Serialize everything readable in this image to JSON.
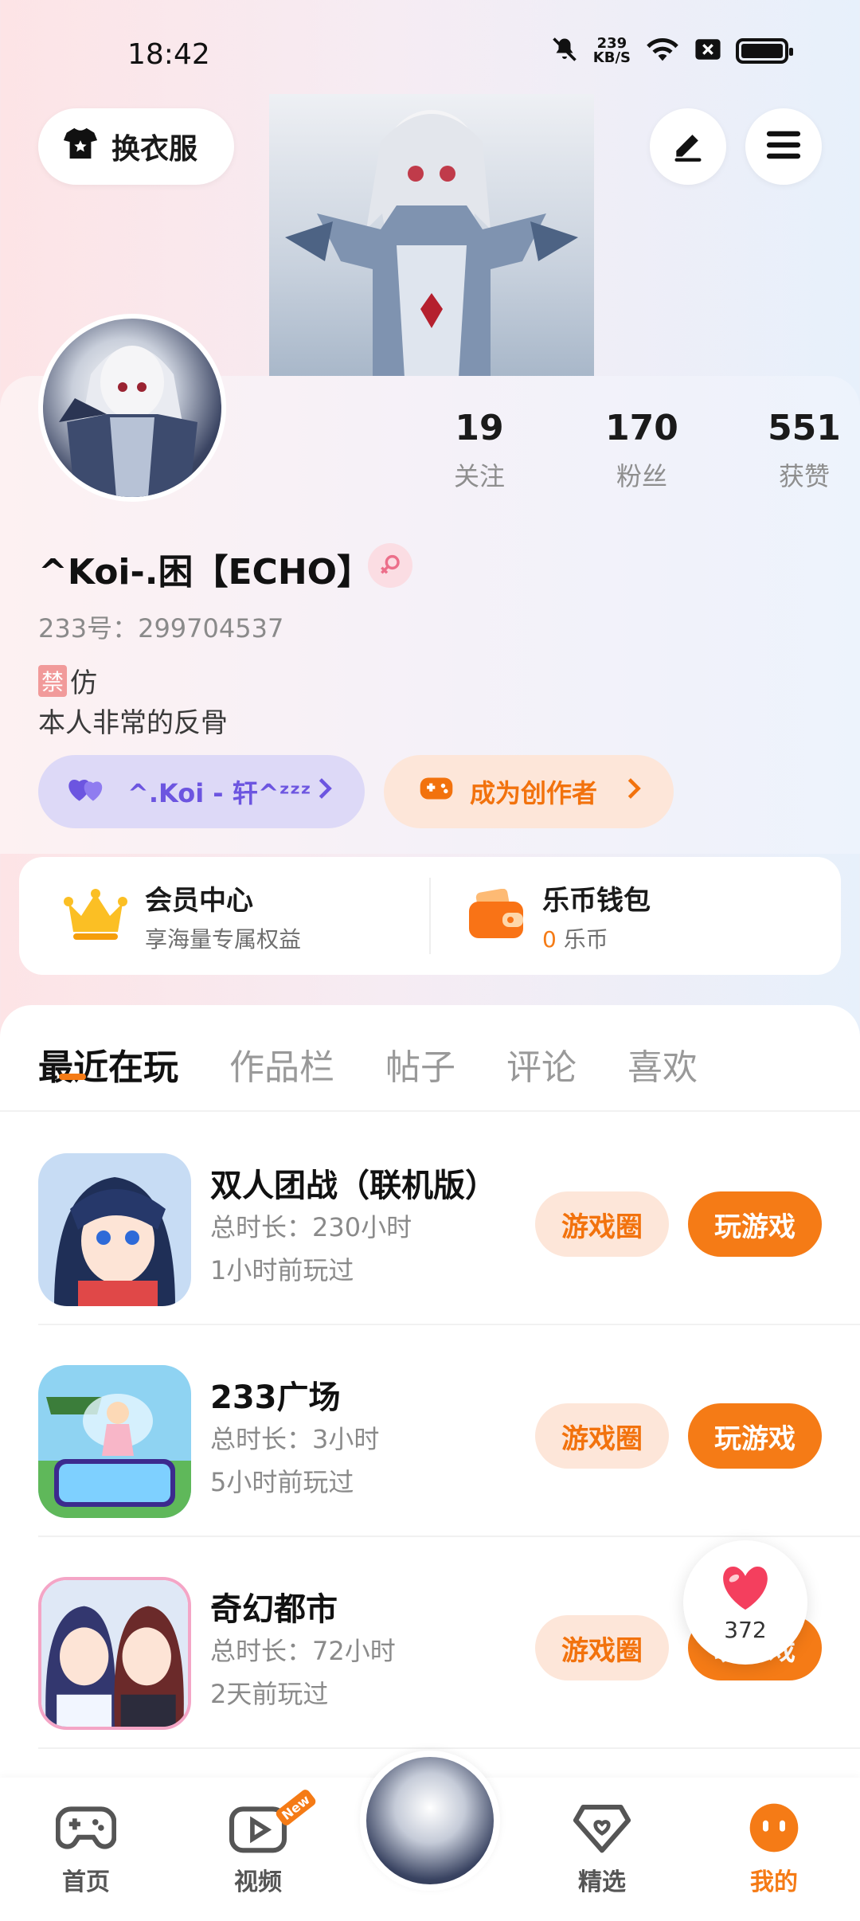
{
  "status_bar": {
    "time": "18:42",
    "net_speed_value": "239",
    "net_speed_unit": "KB/S",
    "icons": [
      "mute-icon",
      "wifi-icon",
      "sim-off-icon",
      "battery-icon"
    ]
  },
  "header": {
    "wardrobe_label": "换衣服",
    "edit_icon": "edit-icon",
    "menu_icon": "menu-icon"
  },
  "profile": {
    "stats": [
      {
        "value": "19",
        "label": "关注"
      },
      {
        "value": "170",
        "label": "粉丝"
      },
      {
        "value": "551",
        "label": "获赞"
      }
    ],
    "nickname": "^Koi-.困【ECHO】",
    "gender_icon": "female-icon",
    "uid": "233号：299704537",
    "bio_tag": "禁",
    "bio_line1": "仿",
    "bio_line2": "本人非常的反骨",
    "guild_chip": "^.Koi - 轩^ᶻᶻᶻ",
    "creator_chip": "成为创作者"
  },
  "member_card": {
    "vip_title": "会员中心",
    "vip_subtitle": "享海量专属权益",
    "wallet_title": "乐币钱包",
    "wallet_amount": "0",
    "wallet_unit": "乐币"
  },
  "tabs": [
    "最近在玩",
    "作品栏",
    "帖子",
    "评论",
    "喜欢"
  ],
  "games": [
    {
      "name": "双人团战（联机版）",
      "time": "总时长：230小时",
      "last": "1小时前玩过"
    },
    {
      "name": "233广场",
      "time": "总时长：3小时",
      "last": "5小时前玩过"
    },
    {
      "name": "奇幻都市",
      "time": "总时长：72小时",
      "last": "2天前玩过"
    }
  ],
  "game_buttons": {
    "circle": "游戏圈",
    "play": "玩游戏"
  },
  "like_float": {
    "count": "372"
  },
  "bottom_nav": [
    {
      "label": "首页",
      "icon": "gamepad-icon"
    },
    {
      "label": "视频",
      "icon": "video-icon",
      "badge": "New"
    },
    {
      "label": "精选",
      "icon": "heart-shield-icon"
    },
    {
      "label": "我的",
      "icon": "profile-icon"
    }
  ],
  "colors": {
    "accent": "#f57b16",
    "guild": "#6c55e0"
  }
}
